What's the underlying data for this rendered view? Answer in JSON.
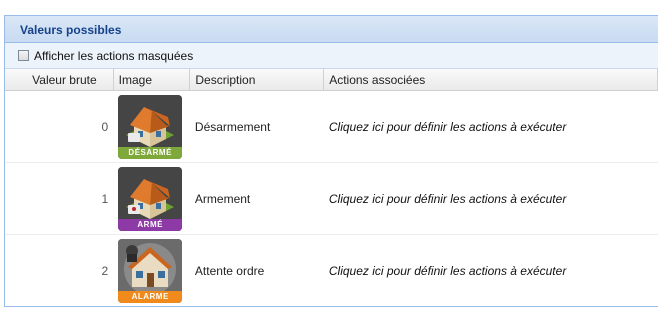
{
  "panel": {
    "title": "Valeurs possibles",
    "show_hidden_label": "Afficher les actions masquées"
  },
  "columns": {
    "raw": "Valeur brute",
    "image": "Image",
    "description": "Description",
    "actions": "Actions associées"
  },
  "rows": [
    {
      "raw": "0",
      "image_label": "DÉSARMÉ",
      "icon": "house-disarmed-icon",
      "label_color": "#7fa83a",
      "description": "Désarmement",
      "action": "Cliquez ici pour définir les actions à exécuter"
    },
    {
      "raw": "1",
      "image_label": "ARMÉ",
      "icon": "house-armed-icon",
      "label_color": "#8e3aa6",
      "description": "Armement",
      "action": "Cliquez ici pour définir les actions à exécuter"
    },
    {
      "raw": "2",
      "image_label": "ALARME",
      "icon": "house-alarm-icon",
      "label_color": "#f08a1c",
      "description": "Attente ordre",
      "action": "Cliquez ici pour définir les actions à exécuter"
    }
  ]
}
